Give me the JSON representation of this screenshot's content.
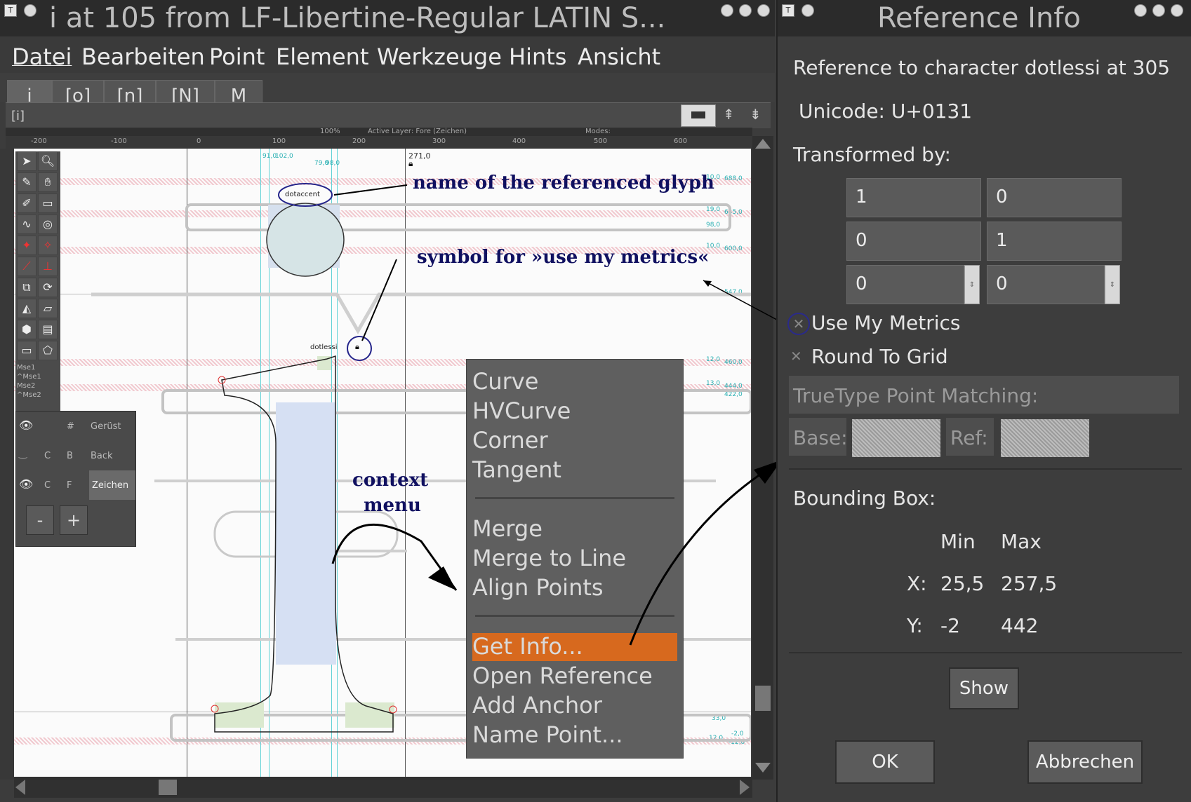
{
  "main_window": {
    "title": "i at 105 from LF-Libertine-Regular LATIN S...",
    "menu": [
      "Datei",
      "Bearbeiten",
      "Point",
      "Element",
      "Werkzeuge",
      "Hints",
      "Ansicht"
    ],
    "tabs": [
      "i",
      "[o]",
      "[n]",
      "[N]",
      "M"
    ],
    "glyph_field": "[i]",
    "info_bar": {
      "zoom": "100%",
      "active_layer": "Active Layer: Fore (Zeichen)",
      "modes": "Modes:"
    },
    "ruler_ticks": [
      "-200",
      "-100",
      "0",
      "100",
      "200",
      "300",
      "400",
      "500",
      "600"
    ],
    "canvas_labels": {
      "top_measure": "271,0",
      "width_a": "91,0",
      "width_b": "102,0",
      "width_c": "79,0",
      "width_d": "98,0",
      "ref_top": "dotaccent",
      "ref_bottom": "dotlessi",
      "right_values": [
        "10,0",
        "688,0",
        "19,0",
        "645,0",
        "98,0",
        "10,0",
        "600,0",
        "547,0",
        "12,0",
        "460,0",
        "13,0",
        "444,0",
        "422,0",
        "33,0",
        "-2,0",
        "12,0",
        "-12,0"
      ]
    },
    "mouse_legend": [
      "Mse1",
      "^Mse1",
      "Mse2",
      "^Mse2"
    ],
    "layers": [
      {
        "visible": true,
        "c": "",
        "f": "#",
        "name": "Gerüst"
      },
      {
        "visible": false,
        "c": "C",
        "f": "B",
        "name": "Back"
      },
      {
        "visible": true,
        "c": "C",
        "f": "F",
        "name": "Zeichen"
      }
    ],
    "layer_buttons": {
      "minus": "-",
      "plus": "+"
    }
  },
  "annotations": {
    "ref_name": "name of the referenced glyph",
    "use_metrics": "symbol for »use my metrics«",
    "context_menu_line1": "context",
    "context_menu_line2": "menu"
  },
  "context_menu": {
    "group1": [
      "Curve",
      "HVCurve",
      "Corner",
      "Tangent"
    ],
    "group2": [
      "Merge",
      "Merge to Line",
      "Align Points"
    ],
    "group3": [
      "Get Info...",
      "Open Reference",
      "Add Anchor",
      "Name Point..."
    ],
    "highlighted": "Get Info...",
    "highlight_color": "#d7691e"
  },
  "dialog": {
    "title": "Reference Info",
    "reference_to": "Reference to character dotlessi at 305",
    "unicode": "Unicode: U+0131",
    "transformed_by": "Transformed by:",
    "matrix": [
      "1",
      "0",
      "0",
      "1",
      "0",
      "0"
    ],
    "use_my_metrics": "Use My Metrics",
    "round_to_grid": "Round To Grid",
    "truetype_point_matching": "TrueType Point Matching:",
    "base_label": "Base:",
    "ref_label": "Ref:",
    "bounding_box": "Bounding Box:",
    "min": "Min",
    "max": "Max",
    "x_label": "X:",
    "x_min": "25,5",
    "x_max": "257,5",
    "y_label": "Y:",
    "y_min": "-2",
    "y_max": "442",
    "show_button": "Show",
    "ok_button": "OK",
    "cancel_button": "Abbrechen"
  }
}
